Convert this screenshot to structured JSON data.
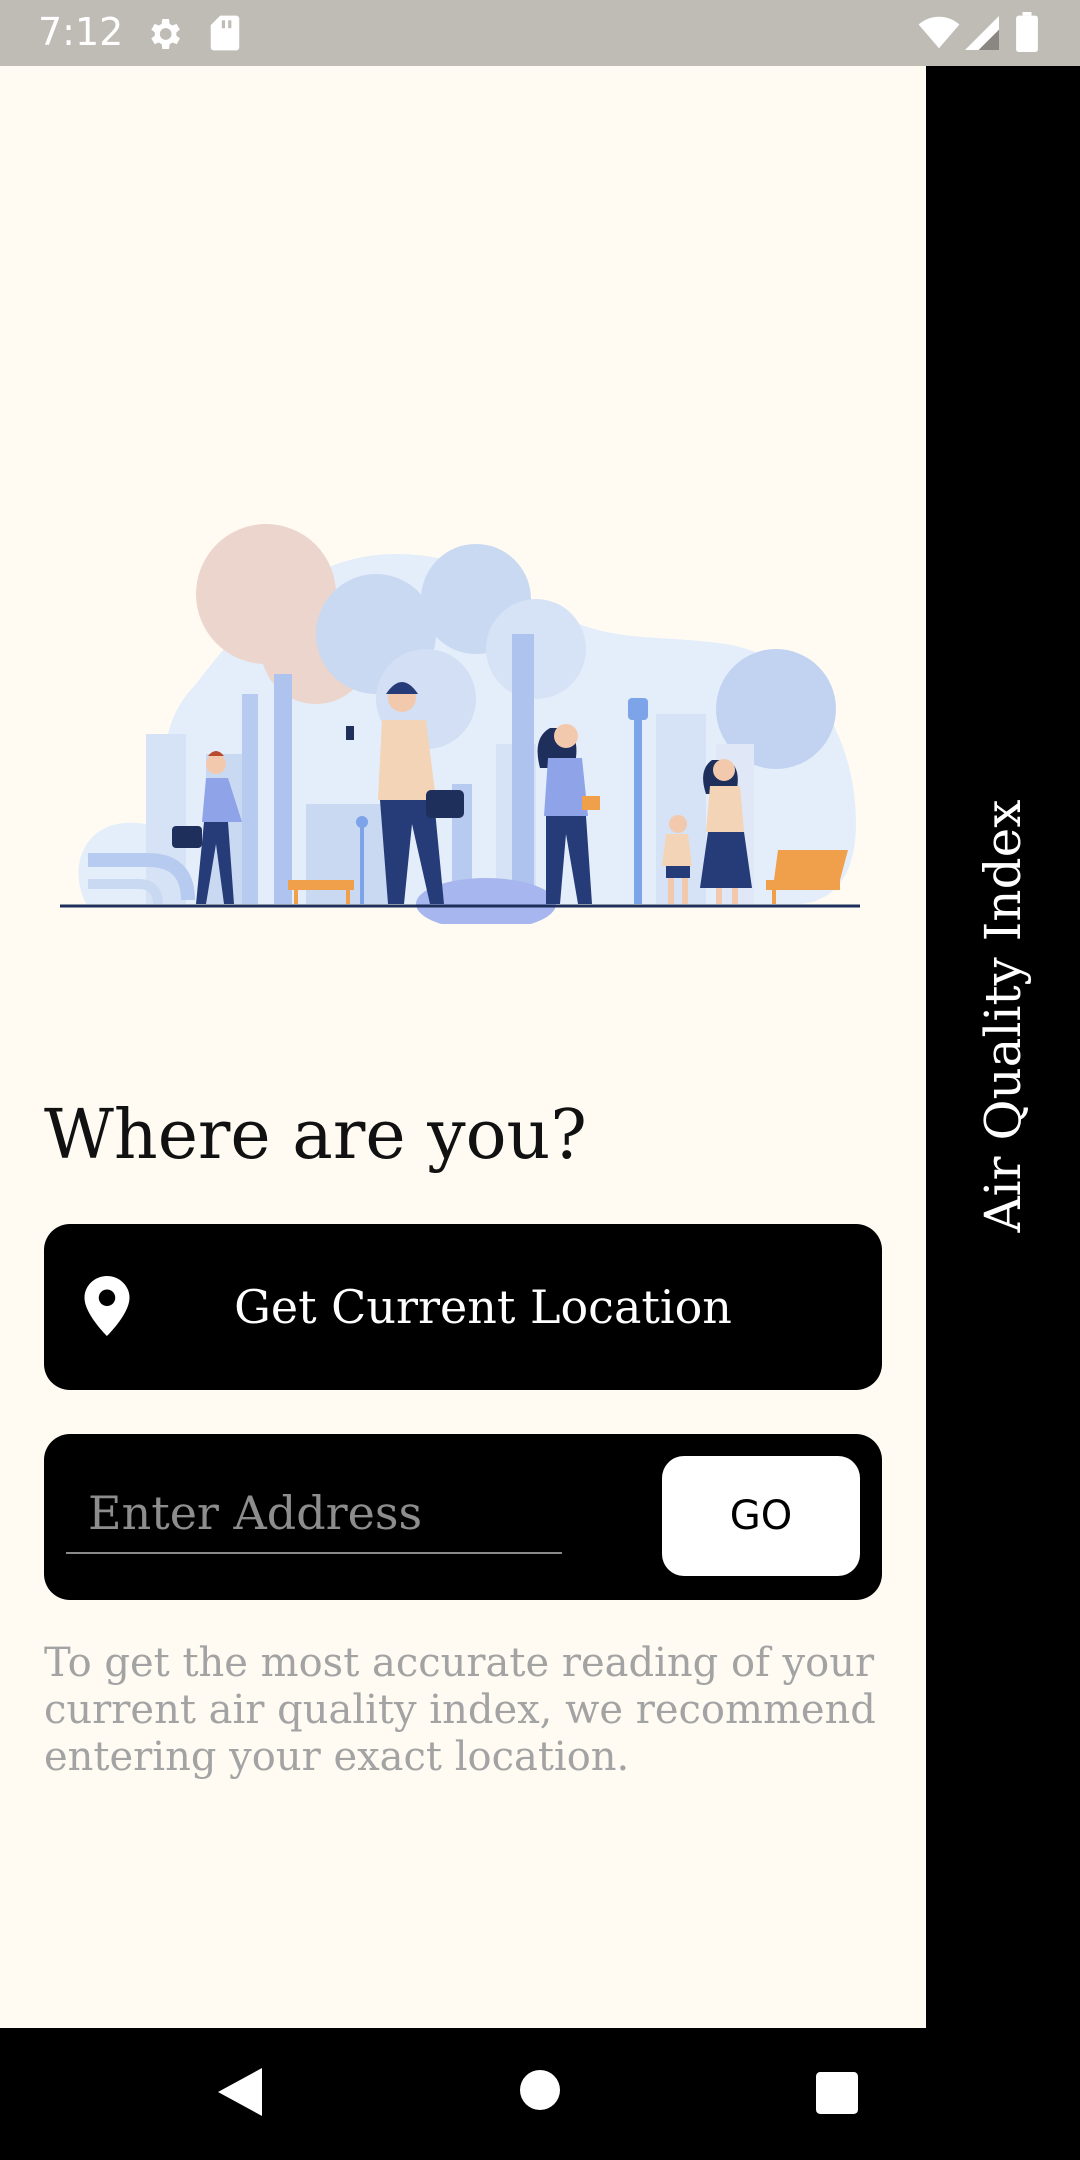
{
  "status_bar": {
    "time": "7:12",
    "icons": [
      "gear-icon",
      "sd-card-icon",
      "wifi-icon",
      "signal-icon",
      "battery-icon"
    ]
  },
  "side_panel": {
    "title": "Air Quality Index"
  },
  "main": {
    "illustration": "city-pollution-illustration",
    "heading": "Where are you?",
    "location_button": {
      "icon": "location-pin-icon",
      "label": "Get Current Location"
    },
    "address": {
      "placeholder": "Enter Address",
      "value": "",
      "go_label": "GO"
    },
    "note": "To get the most accurate reading of your current air quality index, we recommend entering your exact location."
  },
  "nav_bar": {
    "buttons": [
      "back-icon",
      "home-icon",
      "recents-icon"
    ]
  },
  "colors": {
    "background": "#fffbf3",
    "accent": "#000000",
    "status_bar": "#bfbcb6",
    "note_text": "#a3a3a3"
  }
}
